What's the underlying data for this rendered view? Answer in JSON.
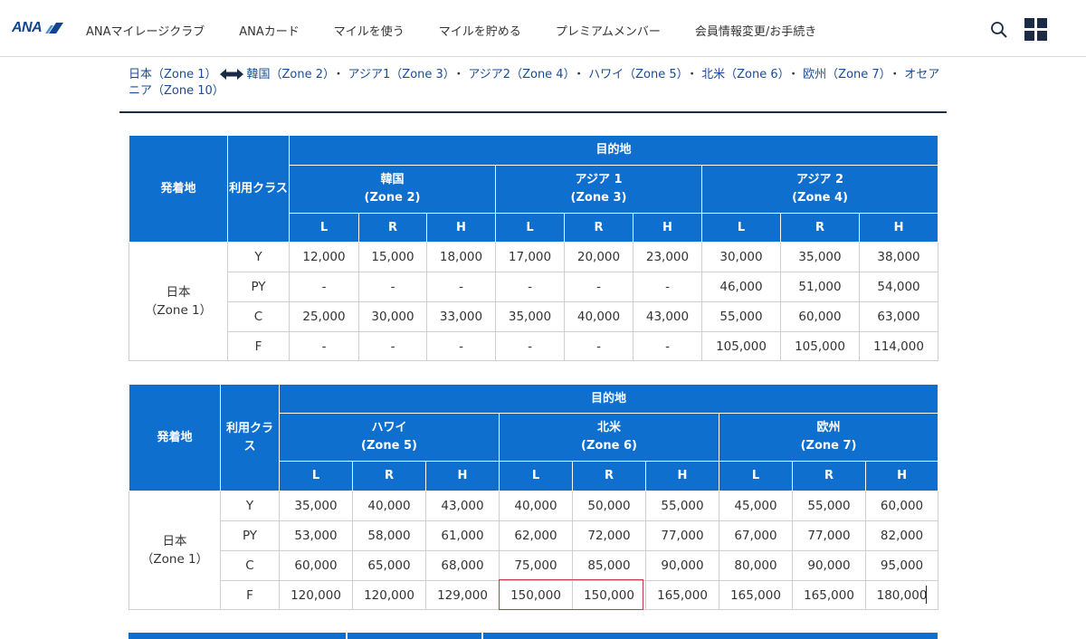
{
  "header": {
    "logo": "ANA",
    "nav": [
      "ANAマイレージクラブ",
      "ANAカード",
      "マイルを使う",
      "マイルを貯める",
      "プレミアムメンバー",
      "会員情報変更/お手続き"
    ]
  },
  "breadcrumb": {
    "origin": "日本（Zone 1）",
    "zones": [
      "韓国（Zone 2）",
      "アジア1（Zone 3）",
      "アジア2（Zone 4）",
      "ハワイ（Zone 5）",
      "北米（Zone 6）",
      "欧州（Zone 7）",
      "オセアニア（Zone 10）"
    ],
    "separator": "・"
  },
  "table1": {
    "origin_header": "発着地",
    "class_header": "利用クラス",
    "dest_header": "目的地",
    "zones": [
      {
        "name": "韓国",
        "zone": "(Zone 2)"
      },
      {
        "name": "アジア 1",
        "zone": "(Zone 3)"
      },
      {
        "name": "アジア 2",
        "zone": "(Zone 4)"
      }
    ],
    "seasons": [
      "L",
      "R",
      "H",
      "L",
      "R",
      "H",
      "L",
      "R",
      "H"
    ],
    "origin": {
      "name": "日本",
      "zone": "（Zone 1）"
    },
    "rows": [
      {
        "class": "Y",
        "values": [
          "12,000",
          "15,000",
          "18,000",
          "17,000",
          "20,000",
          "23,000",
          "30,000",
          "35,000",
          "38,000"
        ]
      },
      {
        "class": "PY",
        "values": [
          "-",
          "-",
          "-",
          "-",
          "-",
          "-",
          "46,000",
          "51,000",
          "54,000"
        ]
      },
      {
        "class": "C",
        "values": [
          "25,000",
          "30,000",
          "33,000",
          "35,000",
          "40,000",
          "43,000",
          "55,000",
          "60,000",
          "63,000"
        ]
      },
      {
        "class": "F",
        "values": [
          "-",
          "-",
          "-",
          "-",
          "-",
          "-",
          "105,000",
          "105,000",
          "114,000"
        ]
      }
    ]
  },
  "table2": {
    "origin_header": "発着地",
    "class_header": "利用クラス",
    "dest_header": "目的地",
    "zones": [
      {
        "name": "ハワイ",
        "zone": "(Zone 5)"
      },
      {
        "name": "北米",
        "zone": "(Zone 6)"
      },
      {
        "name": "欧州",
        "zone": "(Zone 7)"
      }
    ],
    "seasons": [
      "L",
      "R",
      "H",
      "L",
      "R",
      "H",
      "L",
      "R",
      "H"
    ],
    "origin": {
      "name": "日本",
      "zone": "（Zone 1）"
    },
    "rows": [
      {
        "class": "Y",
        "values": [
          "35,000",
          "40,000",
          "43,000",
          "40,000",
          "50,000",
          "55,000",
          "45,000",
          "55,000",
          "60,000"
        ]
      },
      {
        "class": "PY",
        "values": [
          "53,000",
          "58,000",
          "61,000",
          "62,000",
          "72,000",
          "77,000",
          "67,000",
          "77,000",
          "82,000"
        ]
      },
      {
        "class": "C",
        "values": [
          "60,000",
          "65,000",
          "68,000",
          "75,000",
          "85,000",
          "90,000",
          "80,000",
          "90,000",
          "95,000"
        ]
      },
      {
        "class": "F",
        "values": [
          "120,000",
          "120,000",
          "129,000",
          "150,000",
          "150,000",
          "165,000",
          "165,000",
          "165,000",
          "180,000"
        ]
      }
    ]
  },
  "colors": {
    "header_blue": "#0f6fcf",
    "link_blue": "#1a4c96",
    "logo_blue": "#13448f",
    "highlight_red": "#c8374a"
  },
  "icons": [
    "search-icon",
    "app-grid-icon",
    "double-arrow-icon"
  ]
}
